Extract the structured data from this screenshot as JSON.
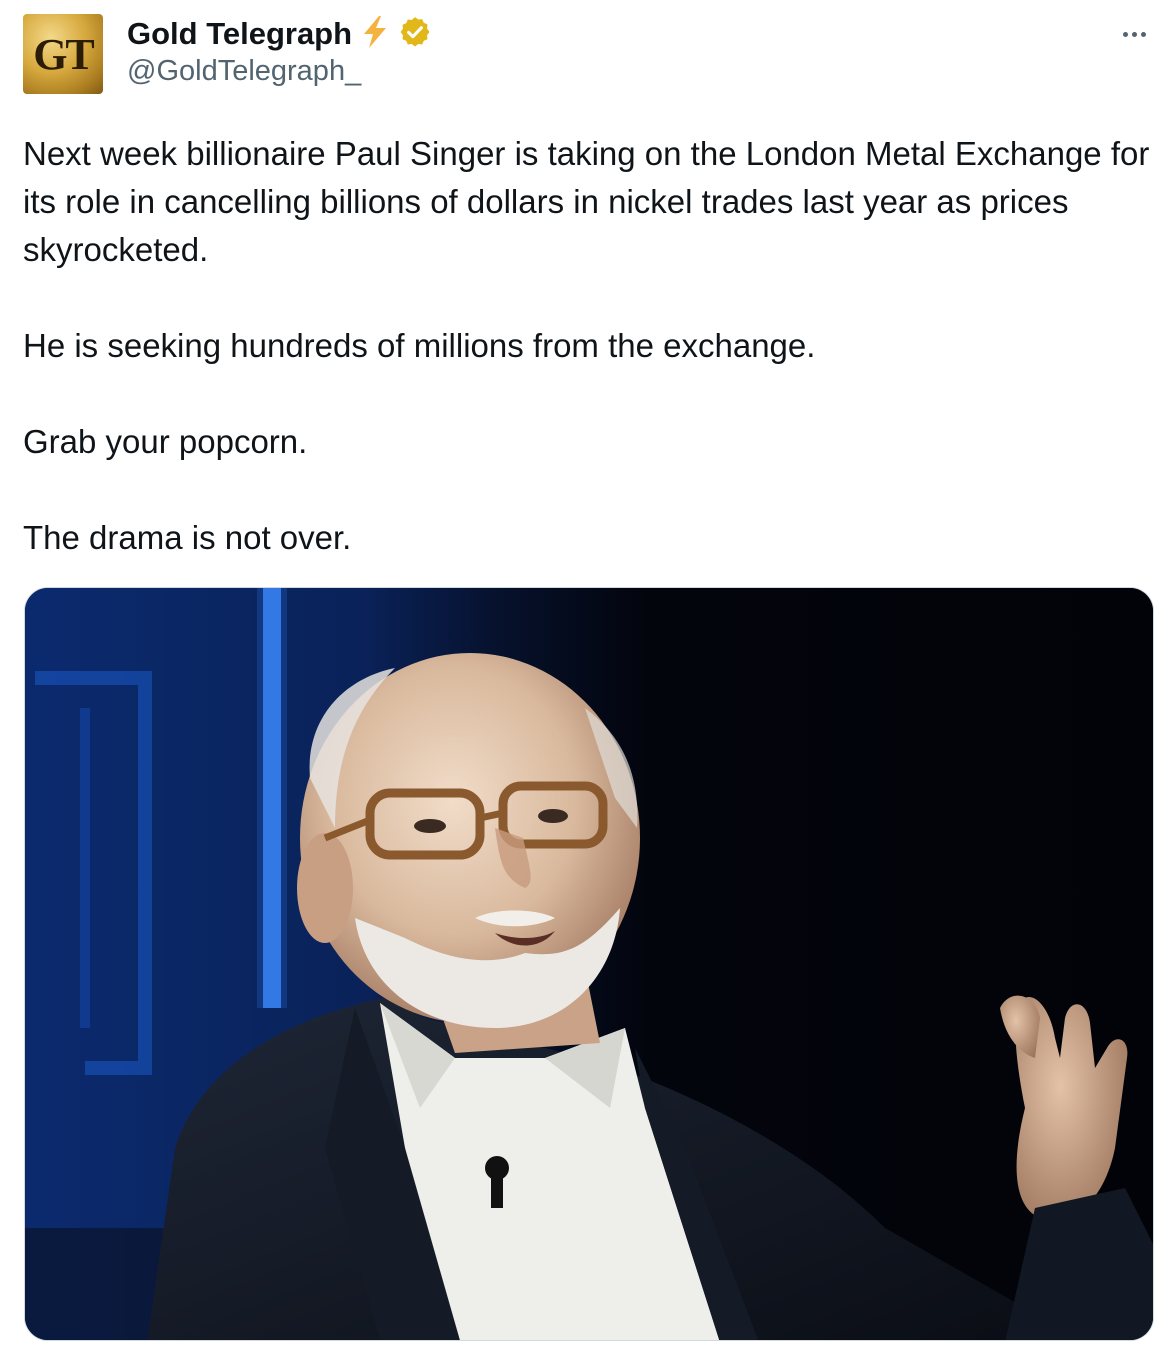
{
  "author": {
    "avatar_text": "GT",
    "display_name": "Gold Telegraph",
    "handle": "@GoldTelegraph_",
    "badge_icon": "lightning-bolt-icon",
    "verified_icon": "verified-badge-icon",
    "verified_color": "#e2b719",
    "bolt_color": "#f4b23e"
  },
  "more_icon": "more-options-icon",
  "tweet": {
    "paragraphs": [
      "Next week billionaire Paul Singer is taking on the London Metal Exchange for its role in cancelling billions of dollars in nickel trades last year as prices skyrocketed.",
      "He is seeking hundreds of millions from the exchange.",
      "Grab your popcorn.",
      "The drama is not over."
    ]
  },
  "colors": {
    "text": "#0f1419",
    "secondary": "#536471",
    "border": "#cfd9de"
  }
}
